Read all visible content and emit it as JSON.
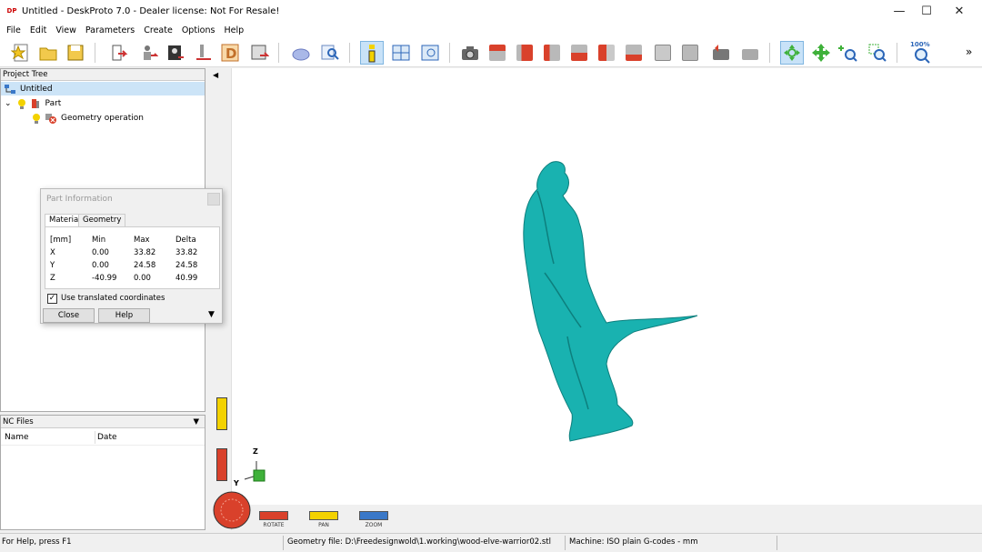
{
  "window": {
    "title": "Untitled - DeskProto 7.0 - Dealer license: Not For Resale!",
    "app_icon_text": "DP",
    "minimize": "—",
    "maximize": "☐",
    "close": "✕"
  },
  "menu": [
    "File",
    "Edit",
    "View",
    "Parameters",
    "Create",
    "Options",
    "Help"
  ],
  "toolbar": {
    "zoom_label": "100%",
    "overflow": "»",
    "colors": {
      "red": "#d9412b",
      "gray": "#b9b9b9",
      "green": "#3fb13a",
      "blue": "#3a78c8"
    }
  },
  "project_tree": {
    "header": "Project Tree",
    "root": "Untitled",
    "part": "Part",
    "operation": "Geometry operation"
  },
  "nc_files": {
    "header": "NC Files",
    "columns": [
      "Name",
      "Date"
    ]
  },
  "part_info_dialog": {
    "title": "Part Information",
    "tabs": [
      "Material",
      "Geometry"
    ],
    "headers": [
      "[mm]",
      "Min",
      "Max",
      "Delta"
    ],
    "rows": [
      [
        "X",
        "0.00",
        "33.82",
        "33.82"
      ],
      [
        "Y",
        "0.00",
        "24.58",
        "24.58"
      ],
      [
        "Z",
        "-40.99",
        "0.00",
        "40.99"
      ]
    ],
    "checkbox_label": "Use translated coordinates",
    "checkbox_checked": true,
    "close_button": "Close",
    "help_button": "Help"
  },
  "viewport": {
    "model_color": "#19b2b0",
    "axes": {
      "z": "Z",
      "y": "Y"
    },
    "sliders": {
      "rotate": "ROTATE",
      "pan": "PAN",
      "zoom": "ZOOM"
    }
  },
  "status": {
    "help": "For Help, press F1",
    "geometry_file": "Geometry file: D:\\Freedesignwold\\1.working\\wood-elve-warrior02.stl",
    "machine": "Machine: ISO plain G-codes - mm"
  }
}
